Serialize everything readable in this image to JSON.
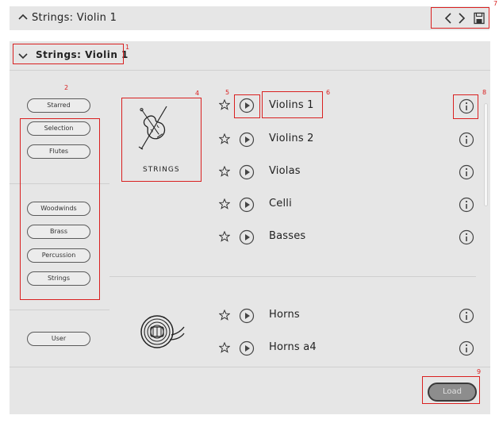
{
  "topbar": {
    "title": "Strings: Violin 1"
  },
  "header": {
    "title": "Strings: Violin 1"
  },
  "annotations": {
    "n1": "1",
    "n2": "2",
    "n4": "4",
    "n5": "5",
    "n6": "6",
    "n7": "7",
    "n8": "8",
    "n9": "9"
  },
  "filters": {
    "starred": "Starred",
    "selection": "Selection",
    "flutes": "Flutes",
    "woodwinds": "Woodwinds",
    "brass": "Brass",
    "percussion": "Percussion",
    "strings": "Strings",
    "user": "User"
  },
  "groups": {
    "strings_caption": "STRINGS"
  },
  "instruments": {
    "strings": [
      "Violins 1",
      "Violins 2",
      "Violas",
      "Celli",
      "Basses"
    ],
    "brass": [
      "Horns",
      "Horns a4"
    ]
  },
  "load": {
    "label": "Load"
  },
  "colors": {
    "annotation": "#d92020",
    "panel": "#e6e6e6"
  },
  "icons": {
    "collapse": "chevron-up-icon",
    "expand": "chevron-down-icon",
    "prev": "chevron-left-icon",
    "next": "chevron-right-icon",
    "save": "floppy-disk-icon",
    "star": "star-icon",
    "play": "play-icon",
    "info": "info-icon",
    "violin": "violin-icon",
    "horn": "french-horn-icon"
  }
}
